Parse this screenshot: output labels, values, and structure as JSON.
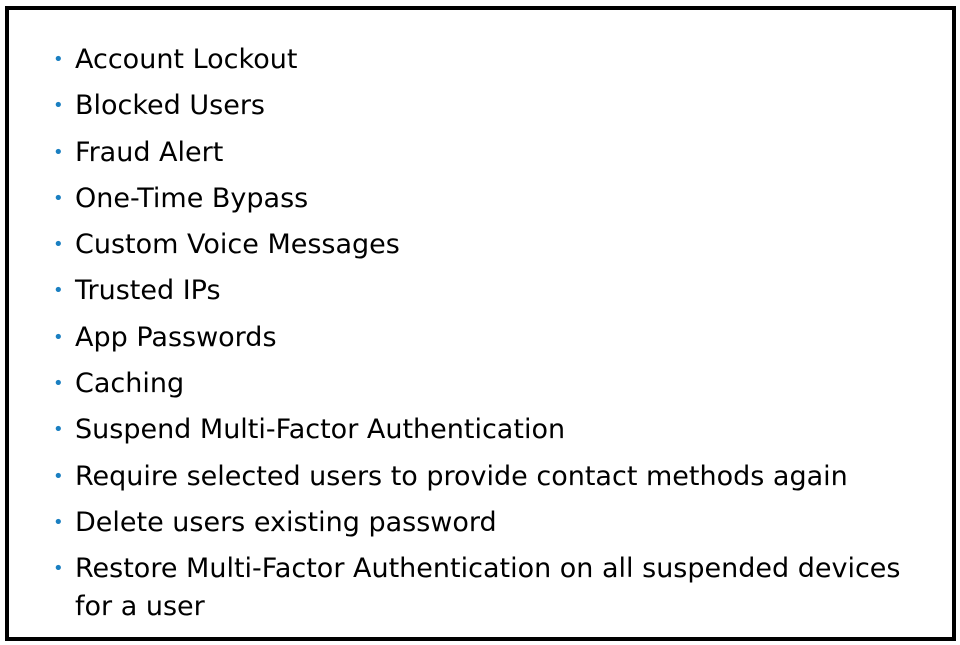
{
  "colors": {
    "bullet": "#1a7fc1",
    "text": "#000000",
    "border": "#000000",
    "background": "#ffffff"
  },
  "bullet_glyph": "•",
  "items": [
    {
      "label": "Account Lockout"
    },
    {
      "label": "Blocked Users"
    },
    {
      "label": "Fraud Alert"
    },
    {
      "label": "One-Time Bypass"
    },
    {
      "label": "Custom Voice Messages"
    },
    {
      "label": "Trusted IPs"
    },
    {
      "label": "App Passwords"
    },
    {
      "label": "Caching"
    },
    {
      "label": "Suspend Multi-Factor Authentication"
    },
    {
      "label": "Require selected users to provide contact methods again"
    },
    {
      "label": "Delete users existing password"
    },
    {
      "label": "Restore Multi-Factor Authentication on all suspended devices for a user"
    }
  ]
}
